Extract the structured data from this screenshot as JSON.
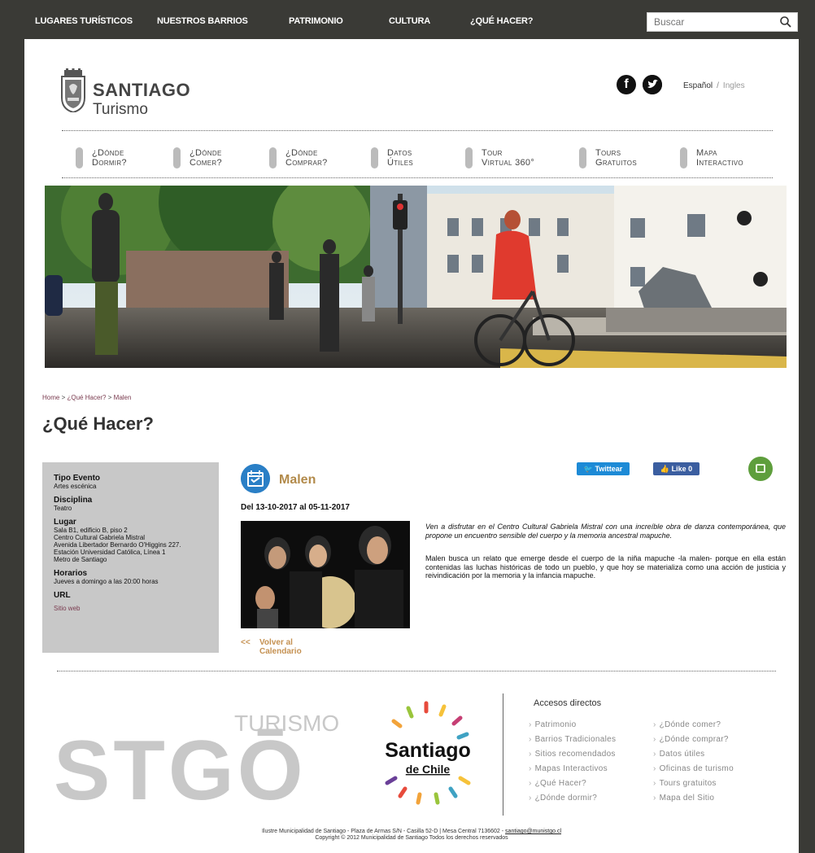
{
  "topnav": {
    "items": [
      "LUGARES TURÍSTICOS",
      "NUESTROS BARRIOS",
      "PATRIMONIO",
      "CULTURA",
      "¿QUÉ HACER?"
    ],
    "search_placeholder": "Buscar"
  },
  "logo": {
    "line1": "SANTIAGO",
    "line2": "Turismo"
  },
  "social": {
    "facebook": "f",
    "twitter": "t"
  },
  "lang": {
    "es": "Español",
    "sep": "/",
    "en": "Ingles"
  },
  "subnav": [
    {
      "l1": "¿Dónde",
      "l2": "Dormir?"
    },
    {
      "l1": "¿Dónde",
      "l2": "Comer?"
    },
    {
      "l1": "¿Dónde",
      "l2": "Comprar?"
    },
    {
      "l1": "Datos",
      "l2": "Útiles"
    },
    {
      "l1": "Tour",
      "l2": "Virtual 360°"
    },
    {
      "l1": "Tours",
      "l2": "Gratuitos"
    },
    {
      "l1": "Mapa",
      "l2": "Interactivo"
    }
  ],
  "breadcrumb": {
    "home": "Home",
    "sep": ">",
    "section": "¿Qué Hacer?",
    "current": "Malen"
  },
  "page_title": "¿Qué Hacer?",
  "sidebar": {
    "tipo_h": "Tipo Evento",
    "tipo_v": "Artes escénica",
    "disc_h": "Disciplina",
    "disc_v": "Teatro",
    "lugar_h": "Lugar",
    "lugar_lines": [
      "Sala B1, edificio B, piso 2",
      "Centro Cultural Gabriela Mistral",
      "Avenida  Libertador Bernardo O'Higgins 227.",
      "Estación Universidad Católica, Línea 1",
      "Metro de Santiago"
    ],
    "hor_h": "Horarios",
    "hor_v": "Jueves a domingo a las 20:00 horas",
    "url_h": "URL",
    "url_v": "Sitio web"
  },
  "event": {
    "title": "Malen",
    "dates": "Del 13-10-2017 al 05-11-2017",
    "p1": "Ven a disfrutar en el Centro Cultural Gabriela Mistral con una increíble  obra de danza contemporánea, que propone un encuentro sensible del cuerpo y la memoria ancestral mapuche.",
    "p2": "Malen busca un relato que emerge desde el cuerpo de la niña mapuche -la malen- porque en ella están contenidas las luchas históricas de todo un pueblo, y que hoy se materializa como una acción de justicia y reivindicación por la memoria y la infancia mapuche.",
    "back_arrow": "<<",
    "back_label": "Volver al Calendario"
  },
  "share": {
    "twitter": "Twittear",
    "facebook": "Like 0"
  },
  "footer_logos": {
    "stgo_small": "TURISMO",
    "stgo_big": "STGŌ",
    "sdc1": "Santiago",
    "sdc2": "de Chile"
  },
  "accesos": {
    "title": "Accesos directos",
    "col1": [
      "Patrimonio",
      "Barrios Tradicionales",
      "Sitios recomendados",
      "Mapas Interactivos",
      "¿Qué Hacer?",
      "¿Dónde dormir?"
    ],
    "col2": [
      "¿Dónde comer?",
      "¿Dónde comprar?",
      "Datos útiles",
      "Oficinas de turismo",
      "Tours gratuitos",
      "Mapa del Sitio"
    ]
  },
  "footer": {
    "line1": "Ilustre Municipalidad de Santiago - Plaza de Armas S/N - Casilla 52-D | Mesa Central 7136602 - ",
    "email": "santiago@munistgo.cl",
    "line2": "Copyright © 2012 Municipalidad de Santiago Todos los derechos reservados"
  },
  "colors": {
    "nav_bg": "#3a3a36",
    "accent_gold": "#b28a4a",
    "link": "#7a3b4f",
    "twitter": "#1d8ad6",
    "facebook": "#3b5ea0",
    "print": "#5e9e3c"
  }
}
